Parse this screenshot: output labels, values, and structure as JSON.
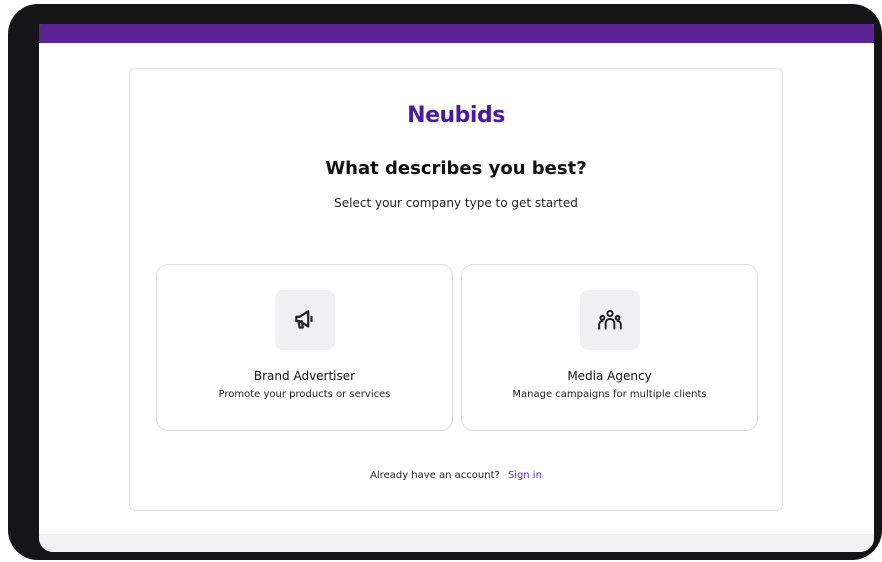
{
  "brand": {
    "name": "Neubids",
    "accent_color": "#5b2393",
    "logo_color": "#4a1aa0"
  },
  "header": {
    "title": "What describes you best?",
    "subtitle": "Select your company type to get started"
  },
  "options": [
    {
      "icon": "megaphone-icon",
      "title": "Brand Advertiser",
      "description": "Promote your products or services"
    },
    {
      "icon": "users-group-icon",
      "title": "Media Agency",
      "description": "Manage campaigns for multiple clients"
    }
  ],
  "footer": {
    "prompt": "Already have an account?",
    "link_label": "Sign in",
    "link_color": "#6a2ec0"
  }
}
